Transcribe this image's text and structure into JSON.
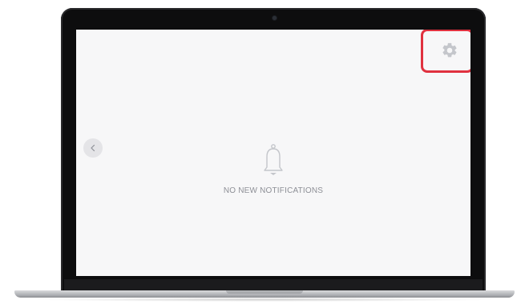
{
  "screen": {
    "empty_state": {
      "message": "NO NEW NOTIFICATIONS",
      "icon": "bell-icon"
    },
    "settings": {
      "icon": "gear-icon",
      "highlighted": true
    },
    "back": {
      "icon": "chevron-left-icon"
    }
  },
  "colors": {
    "screen_background": "#f7f7f8",
    "highlight": "#e0313f",
    "icon": "#c4c6cb",
    "text": "#8d8f96"
  }
}
